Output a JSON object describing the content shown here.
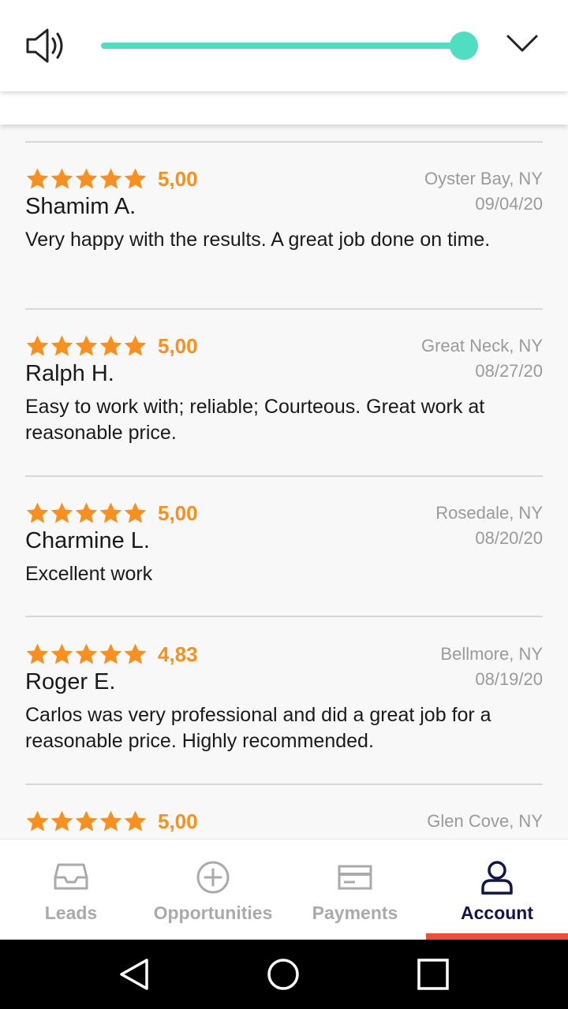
{
  "volume": {
    "level": 0.95,
    "accent_color": "#4fdfc0"
  },
  "reviews": [
    {
      "rating": "5,00",
      "stars": 5,
      "name": "Shamim A.",
      "location": "Oyster Bay, NY",
      "date": "09/04/20",
      "text": "Very happy with the results. A great job done on time."
    },
    {
      "rating": "5,00",
      "stars": 5,
      "name": "Ralph H.",
      "location": "Great Neck, NY",
      "date": "08/27/20",
      "text": "Easy to work with; reliable; Courteous. Great work at reasonable price."
    },
    {
      "rating": "5,00",
      "stars": 5,
      "name": "Charmine L.",
      "location": "Rosedale, NY",
      "date": "08/20/20",
      "text": "Excellent work"
    },
    {
      "rating": "4,83",
      "stars": 5,
      "name": "Roger E.",
      "location": "Bellmore, NY",
      "date": "08/19/20",
      "text": "Carlos was very professional and did a great job for a reasonable price. Highly recommended."
    },
    {
      "rating": "5,00",
      "stars": 5,
      "name": "",
      "location": "Glen Cove, NY",
      "date": "",
      "text": ""
    }
  ],
  "star_color": "#f7901e",
  "tabs": [
    {
      "label": "Leads",
      "icon": "inbox-icon",
      "active": false
    },
    {
      "label": "Opportunities",
      "icon": "plus-circle-icon",
      "active": false
    },
    {
      "label": "Payments",
      "icon": "credit-card-icon",
      "active": false
    },
    {
      "label": "Account",
      "icon": "user-icon",
      "active": true
    }
  ],
  "active_tab_color": "#ef4f36"
}
